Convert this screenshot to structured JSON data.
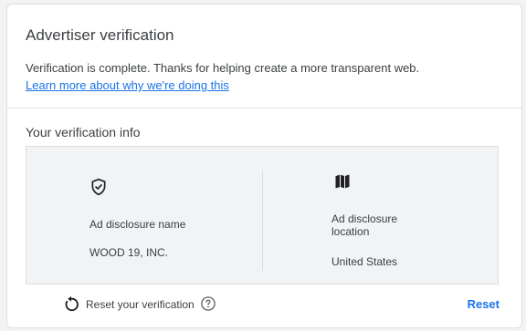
{
  "card": {
    "title": "Advertiser verification",
    "description": "Verification is complete. Thanks for helping create a more transparent web.",
    "learn_more_link": "Learn more about why we're doing this"
  },
  "verification_info": {
    "section_title": "Your verification info",
    "name": {
      "icon": "shield-check-icon",
      "label": "Ad disclosure name",
      "value": "WOOD 19, INC."
    },
    "location": {
      "icon": "map-icon",
      "label": "Ad disclosure location",
      "value": "United States"
    }
  },
  "reset": {
    "icon": "reset-icon",
    "label": "Reset your verification",
    "help_icon": "help-icon",
    "button_label": "Reset"
  },
  "colors": {
    "link": "#1a73e8",
    "text": "#3c4043",
    "panel_bg": "#f1f3f4"
  }
}
